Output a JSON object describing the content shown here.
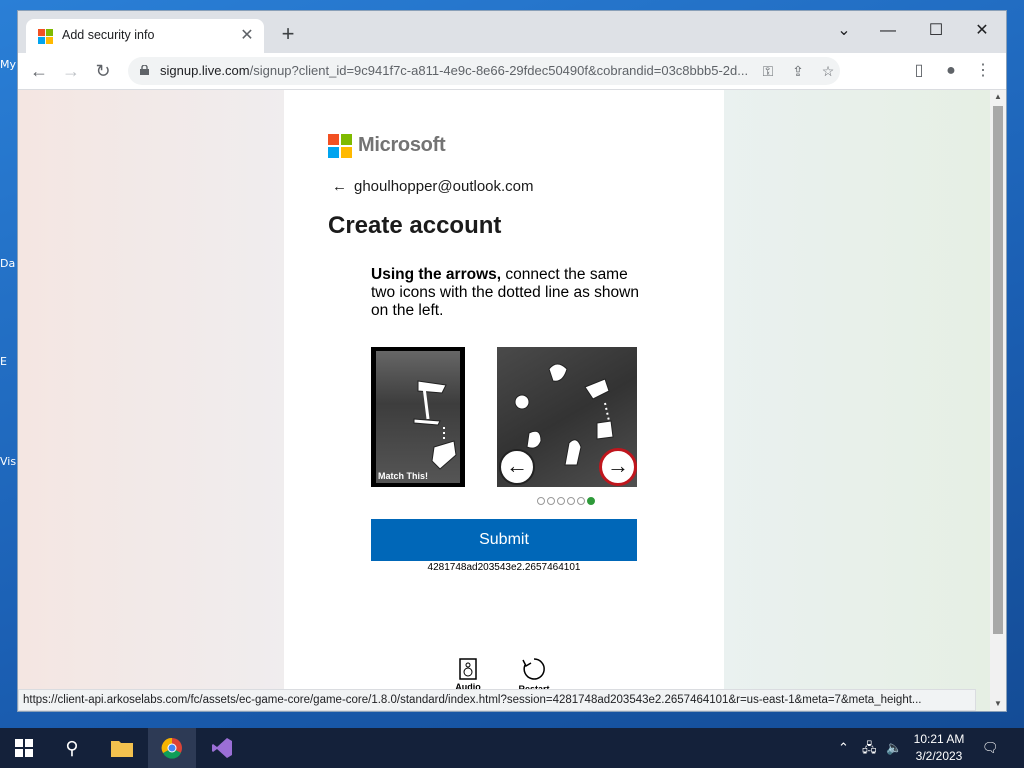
{
  "desktop": {
    "labels": [
      "My",
      "Da",
      "E",
      "Vis"
    ]
  },
  "browser": {
    "tab_title": "Add security info",
    "tab_close": "✕",
    "new_tab": "+",
    "url_host": "signup.live.com",
    "url_rest": "/signup?client_id=9c941f7c-a811-4e9c-8e66-29fdec50490f&cobrandid=03c8bbb5-2d...",
    "status_url": "https://client-api.arkoselabs.com/fc/assets/ec-game-core/game-core/1.8.0/standard/index.html?session=4281748ad203543e2.2657464101&r=us-east-1&meta=7&meta_height..."
  },
  "page": {
    "brand": "Microsoft",
    "email": "ghoulhopper@outlook.com",
    "title": "Create account",
    "instruction_bold": "Using the arrows,",
    "instruction_rest": " connect the same two icons with the dotted line as shown on the left.",
    "match_label": "Match This!",
    "submit_label": "Submit",
    "session_id": "4281748ad203543e2.2657464101",
    "audio_label": "Audio",
    "restart_label": "Restart",
    "puzzle_pages": 6,
    "puzzle_active_page": 6
  },
  "taskbar": {
    "time": "10:21 AM",
    "date": "3/2/2023"
  },
  "colors": {
    "accent": "#0067b8",
    "arrow_highlight": "#c0161d",
    "active_dot": "#2e9a3a"
  }
}
